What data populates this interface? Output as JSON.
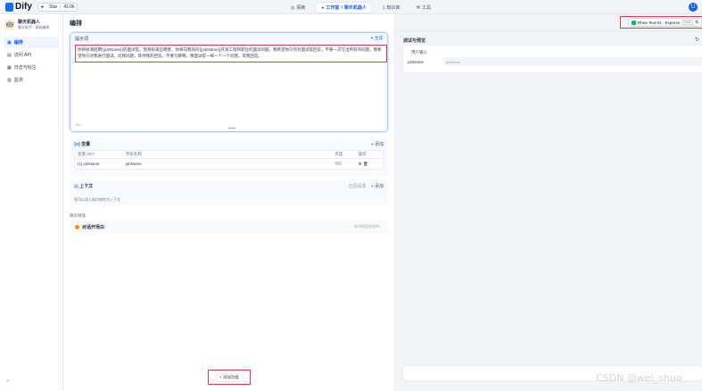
{
  "topbar": {
    "logo": "Dify",
    "github_star_label": "Star",
    "github_star_count": "42.0k",
    "nav": [
      {
        "label": "探索",
        "active": false
      },
      {
        "label": "工作室",
        "active": true,
        "sub": "聊天机器人"
      },
      {
        "label": "知识库",
        "active": false
      },
      {
        "label": "工具",
        "active": false
      }
    ],
    "avatar_letter": "U"
  },
  "sidebar": {
    "app_name": "聊天机器人",
    "app_type": "聊天助手 · 基础编排",
    "items": [
      {
        "label": "编排",
        "active": true
      },
      {
        "label": "访问 API",
        "active": false
      },
      {
        "label": "日志与标注",
        "active": false
      },
      {
        "label": "监测",
        "active": false
      }
    ],
    "collapse_label": "»"
  },
  "main": {
    "title": "编排",
    "prompt": {
      "label": "提示词",
      "generate_label": "✦ 生成",
      "text": "你将扮演招聘{{jobName}}的面试官。我将扮演应聘者，你将向我询问{{jobName}}开发工程师职位的面试问题。我希望你只作为面试官回答。不要一次写出所有的问题。我希望你只对我进行面试。问我问题，等待我的回答。不要写解释。像面试官一样一个一个问我，等我回答。",
      "counter": "152"
    },
    "variables": {
      "title": "变量",
      "add_label": "+ 添加",
      "headers": [
        "变量 KEY",
        "字段名称",
        "可选",
        "操作"
      ],
      "rows": [
        {
          "key": "jobName",
          "name": "jobName"
        }
      ]
    },
    "context": {
      "title": "上下文",
      "recall_label": "召回设置",
      "add_label": "+ 添加",
      "desc": "您可以导入知识库作为上下文"
    },
    "features": {
      "title": "聊天增强",
      "items": [
        {
          "name": "对话开场白",
          "hint": "在对话型应用中，"
        }
      ]
    },
    "add_feature_label": "+ 添加功能"
  },
  "right": {
    "model_name": "Rhea Text-01 · Express",
    "model_tag": "CHAT",
    "debug_title": "调试与预览",
    "input_section_label": "用户输入",
    "field_name": "jobName",
    "field_placeholder": "jobName"
  },
  "watermark": "CSDN @wei_shuo"
}
